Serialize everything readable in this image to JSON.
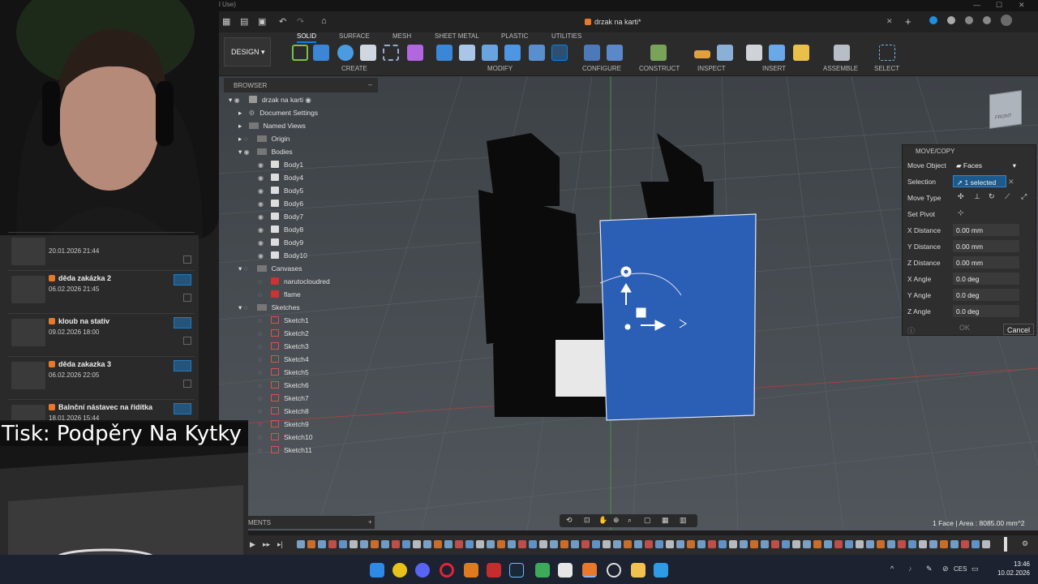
{
  "titlebar": {
    "title": "l Use)"
  },
  "document": {
    "tab_title": "drzak na karti*"
  },
  "ribbon": {
    "design_label": "DESIGN",
    "tabs": [
      "SOLID",
      "SURFACE",
      "MESH",
      "SHEET METAL",
      "PLASTIC",
      "UTILITIES"
    ],
    "groups": [
      "CREATE",
      "MODIFY",
      "CONFIGURE",
      "CONSTRUCT",
      "INSPECT",
      "INSERT",
      "ASSEMBLE",
      "SELECT"
    ]
  },
  "data_panel": {
    "cards": [
      {
        "name": "",
        "date": "20.01.2026 21:44"
      },
      {
        "name": "děda zakázka 2",
        "date": "06.02.2026 21:45"
      },
      {
        "name": "kloub na stativ",
        "date": "09.02.2026 18:00"
      },
      {
        "name": "děda zakazka 3",
        "date": "06.02.2026 22:05"
      },
      {
        "name": "Balnční nástavec na řidítka",
        "date": "18.01.2026 15:44"
      }
    ]
  },
  "overlay": {
    "print_label": "Tisk: Podpěry Na Kytky"
  },
  "browser": {
    "title": "BROWSER",
    "root": "drzak na karti",
    "document_settings": "Document Settings",
    "named_views": "Named Views",
    "origin": "Origin",
    "bodies_label": "Bodies",
    "bodies": [
      "Body1",
      "Body4",
      "Body5",
      "Body6",
      "Body7",
      "Body8",
      "Body9",
      "Body10"
    ],
    "canvases_label": "Canvases",
    "canvases": [
      "narutocloudred",
      "flame"
    ],
    "sketches_label": "Sketches",
    "sketches": [
      "Sketch1",
      "Sketch2",
      "Sketch3",
      "Sketch4",
      "Sketch5",
      "Sketch6",
      "Sketch7",
      "Sketch8",
      "Sketch9",
      "Sketch10",
      "Sketch11"
    ]
  },
  "move_copy": {
    "title": "MOVE/COPY",
    "move_object_label": "Move Object",
    "move_object_value": "Faces",
    "selection_label": "Selection",
    "selection_value": "1 selected",
    "move_type_label": "Move Type",
    "set_pivot_label": "Set Pivot",
    "x_distance_label": "X Distance",
    "x_distance": "0.00 mm",
    "y_distance_label": "Y Distance",
    "y_distance": "0.00 mm",
    "z_distance_label": "Z Distance",
    "z_distance": "0.00 mm",
    "x_angle_label": "X Angle",
    "x_angle": "0.0 deg",
    "y_angle_label": "Y Angle",
    "y_angle": "0.0 deg",
    "z_angle_label": "Z Angle",
    "z_angle": "0.0 deg",
    "ok_label": "OK",
    "cancel_label": "Cancel"
  },
  "viewcube": {
    "label": "FRONT"
  },
  "bottom": {
    "comments_label": "MENTS",
    "status": "1 Face | Area : 8085.00 mm^2"
  },
  "taskbar": {
    "language": "CES",
    "time": "13:46",
    "date": "10.02.2026"
  },
  "colors": {
    "accent": "#0a83e6",
    "face_blue": "#2b5fb5",
    "fusion_orange": "#e8792a"
  }
}
